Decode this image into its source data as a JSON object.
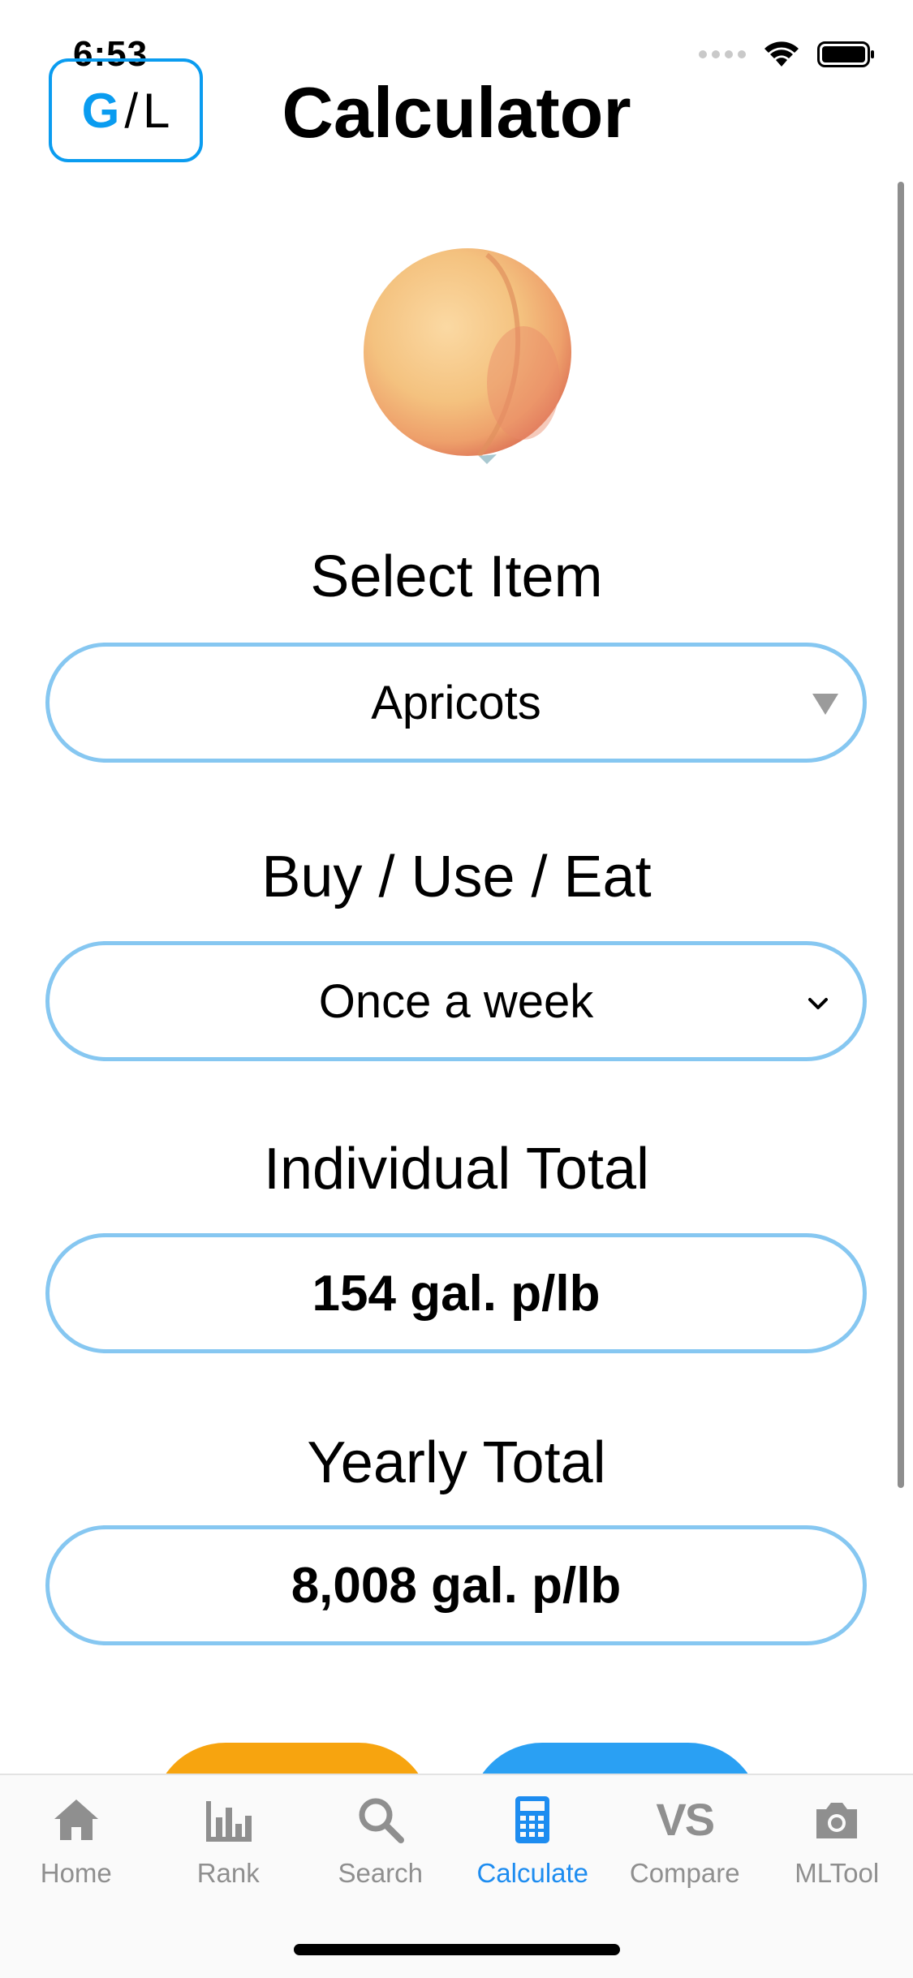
{
  "status_bar": {
    "time": "6:53"
  },
  "header": {
    "toggle_g": "G",
    "toggle_sep": "/",
    "toggle_l": "L",
    "title": "Calculator"
  },
  "fruit_image": {
    "icon": "peach-image"
  },
  "select_item": {
    "label": "Select Item",
    "value": "Apricots"
  },
  "frequency": {
    "label": "Buy / Use / Eat",
    "value": "Once a week"
  },
  "individual_total": {
    "label": "Individual Total",
    "value": "154 gal. p/lb"
  },
  "yearly_total": {
    "label": "Yearly Total",
    "value": "8,008 gal. p/lb"
  },
  "colors": {
    "accent": "#0a9cf0",
    "field_border": "#86c7f1",
    "orange_button": "#f7a40f",
    "blue_button": "#2aa0f3",
    "tab_active": "#1d8cf0",
    "tab_inactive": "#8f8f8f"
  },
  "tabs": [
    {
      "label": "Home",
      "icon": "house-icon",
      "active": false
    },
    {
      "label": "Rank",
      "icon": "bar-chart-icon",
      "active": false
    },
    {
      "label": "Search",
      "icon": "magnifier-icon",
      "active": false
    },
    {
      "label": "Calculate",
      "icon": "calculator-icon",
      "active": true
    },
    {
      "label": "Compare",
      "icon": "vs-icon",
      "icon_text": "VS",
      "active": false
    },
    {
      "label": "MLTool",
      "icon": "camera-icon",
      "active": false
    }
  ]
}
